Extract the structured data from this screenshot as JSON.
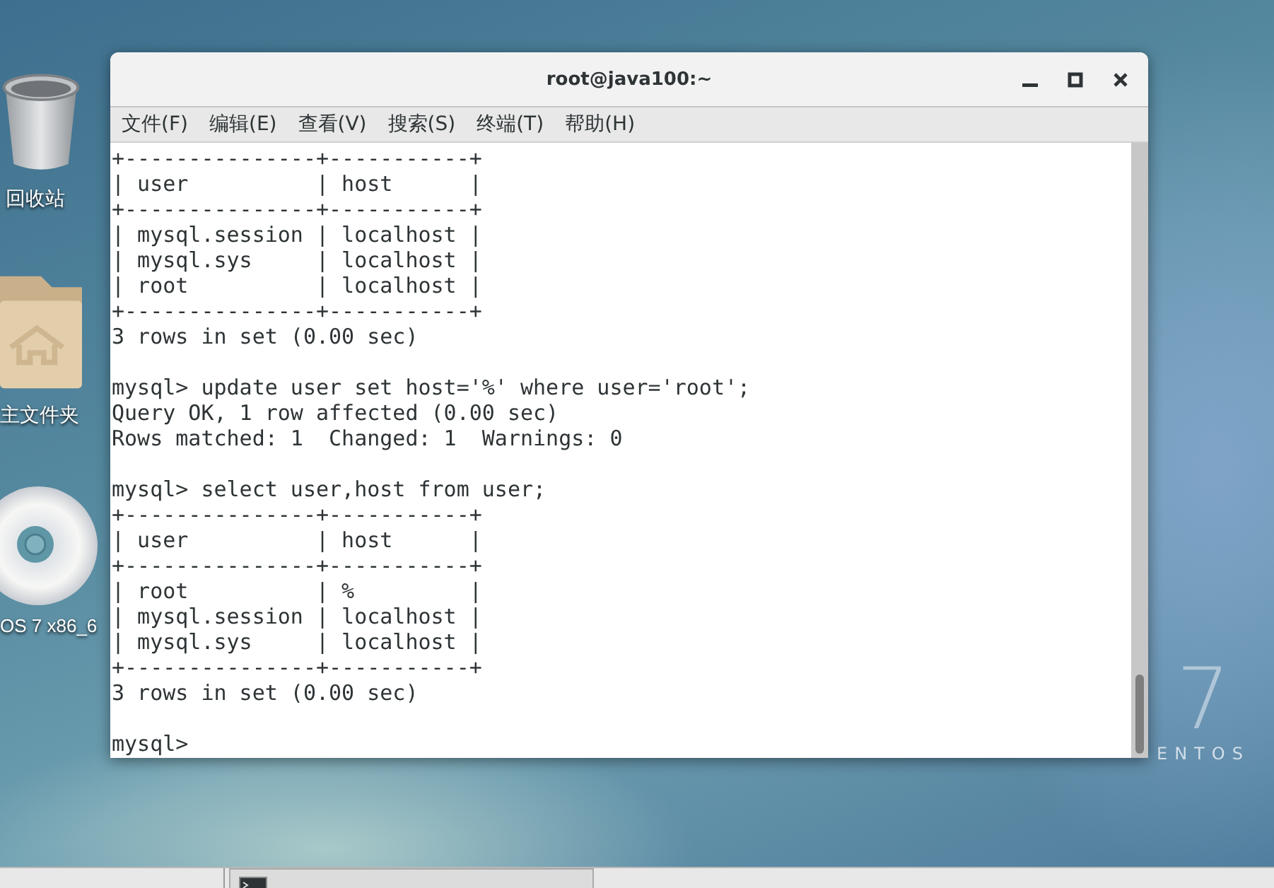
{
  "desktop": {
    "icons": [
      {
        "kind": "trash",
        "label": "回收站"
      },
      {
        "kind": "folder",
        "label": "主文件夹"
      },
      {
        "kind": "disc",
        "label": "OS 7 x86_6"
      }
    ],
    "logo": {
      "numeral": "7",
      "wordmark": "ENTOS"
    }
  },
  "window": {
    "title": "root@java100:~",
    "menu": [
      "文件(F)",
      "编辑(E)",
      "查看(V)",
      "搜索(S)",
      "终端(T)",
      "帮助(H)"
    ],
    "terminal": {
      "blocks": [
        [
          "+---------------+-----------+",
          "| user          | host      |",
          "+---------------+-----------+",
          "| mysql.session | localhost |",
          "| mysql.sys     | localhost |",
          "| root          | localhost |",
          "+---------------+-----------+",
          "3 rows in set (0.00 sec)"
        ],
        [
          "mysql> update user set host='%' where user='root';",
          "Query OK, 1 row affected (0.00 sec)",
          "Rows matched: 1  Changed: 1  Warnings: 0"
        ],
        [
          "mysql> select user,host from user;",
          "+---------------+-----------+",
          "| user          | host      |",
          "+---------------+-----------+",
          "| root          | %         |",
          "| mysql.session | localhost |",
          "| mysql.sys     | localhost |",
          "+---------------+-----------+",
          "3 rows in set (0.00 sec)"
        ],
        [
          "mysql>"
        ]
      ]
    }
  }
}
